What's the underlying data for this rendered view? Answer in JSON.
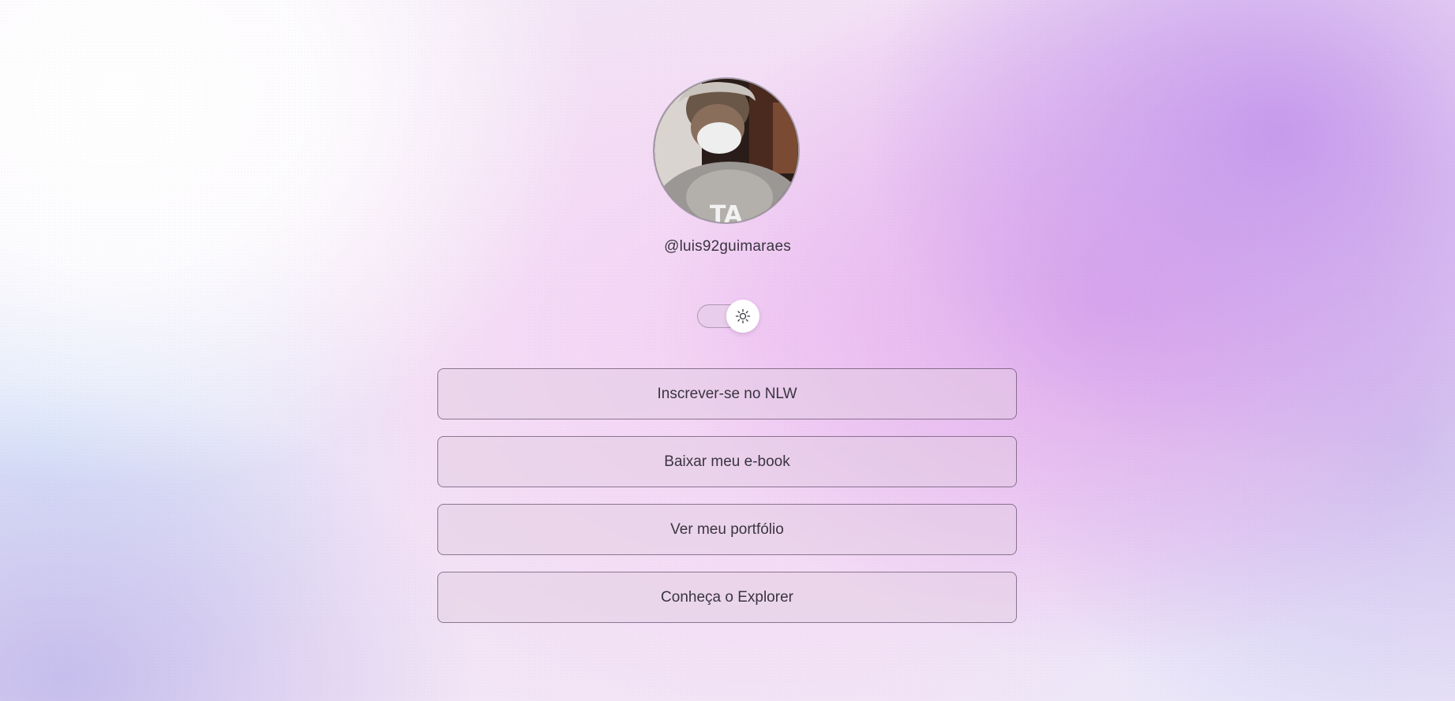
{
  "profile": {
    "username": "@luis92guimaraes",
    "avatar_alt": "avatar"
  },
  "theme_switch": {
    "state": "light",
    "icon": "sun-icon"
  },
  "links": [
    {
      "label": "Inscrever-se no NLW"
    },
    {
      "label": "Baixar meu e-book"
    },
    {
      "label": "Ver meu portfólio"
    },
    {
      "label": "Conheça o Explorer"
    }
  ],
  "colors": {
    "text": "#3a3540",
    "button_border": "#5a4a62",
    "accent_purple": "#c498ec",
    "accent_pink": "#dea6ec"
  }
}
